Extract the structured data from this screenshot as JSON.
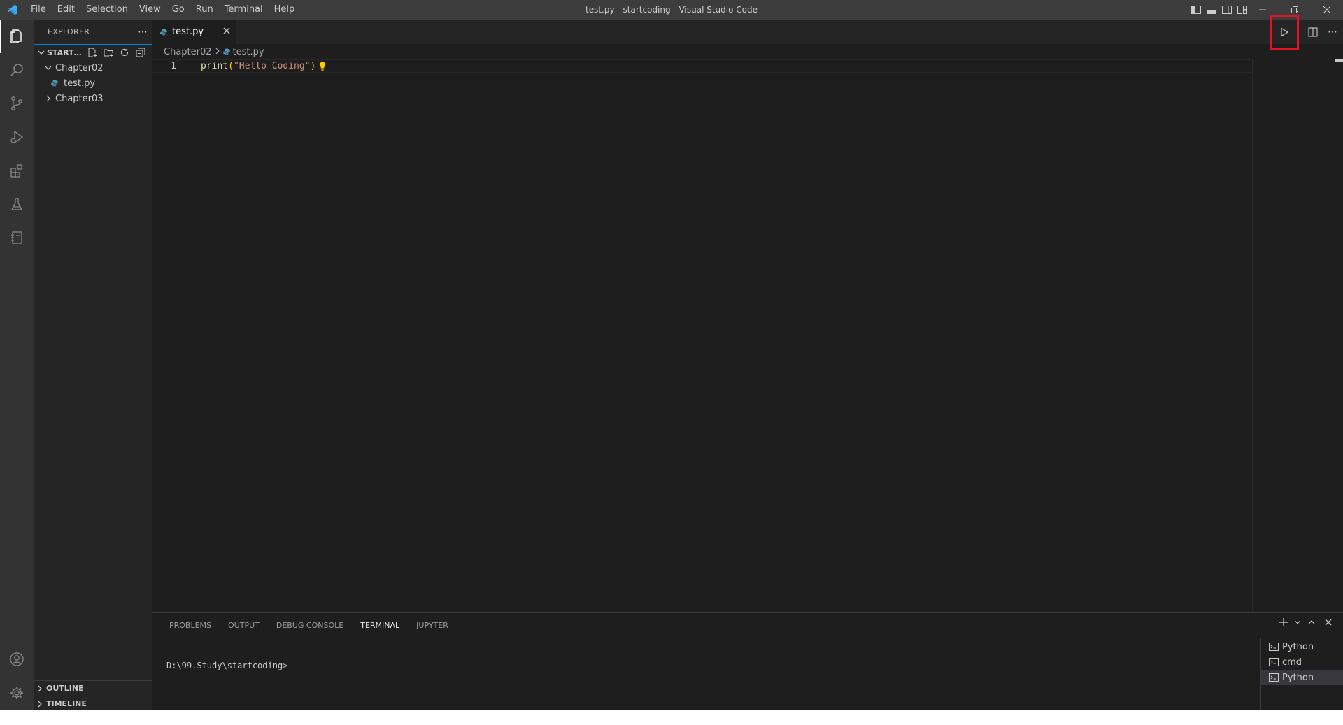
{
  "titlebar": {
    "window_title": "test.py - startcoding - Visual Studio Code",
    "menu": [
      "File",
      "Edit",
      "Selection",
      "View",
      "Go",
      "Run",
      "Terminal",
      "Help"
    ]
  },
  "sidebar": {
    "title": "EXPLORER",
    "workspace_name": "STARTC...",
    "tree": [
      {
        "label": "Chapter02",
        "type": "folder",
        "expanded": true
      },
      {
        "label": "test.py",
        "type": "file"
      },
      {
        "label": "Chapter03",
        "type": "folder",
        "expanded": false
      }
    ],
    "sections": [
      "OUTLINE",
      "TIMELINE"
    ]
  },
  "editor": {
    "tab_label": "test.py",
    "breadcrumb": [
      "Chapter02",
      "test.py"
    ],
    "line_number": "1",
    "code": {
      "fn": "print",
      "open": "(",
      "str": "\"Hello Coding\"",
      "close": ")"
    }
  },
  "panel": {
    "tabs": [
      "PROBLEMS",
      "OUTPUT",
      "DEBUG CONSOLE",
      "TERMINAL",
      "JUPYTER"
    ],
    "active_tab": "TERMINAL",
    "terminal_prompt": "D:\\99.Study\\startcoding>",
    "terminals": [
      "Python",
      "cmd",
      "Python"
    ],
    "selected_terminal_index": 2
  },
  "colors": {
    "accent_focus": "#007fd4",
    "highlight_box": "#e81123",
    "vscode_blue": "#3ca7f5"
  },
  "icons": {
    "run": "play-icon",
    "split": "split-editor-icon",
    "more": "more-icon"
  }
}
